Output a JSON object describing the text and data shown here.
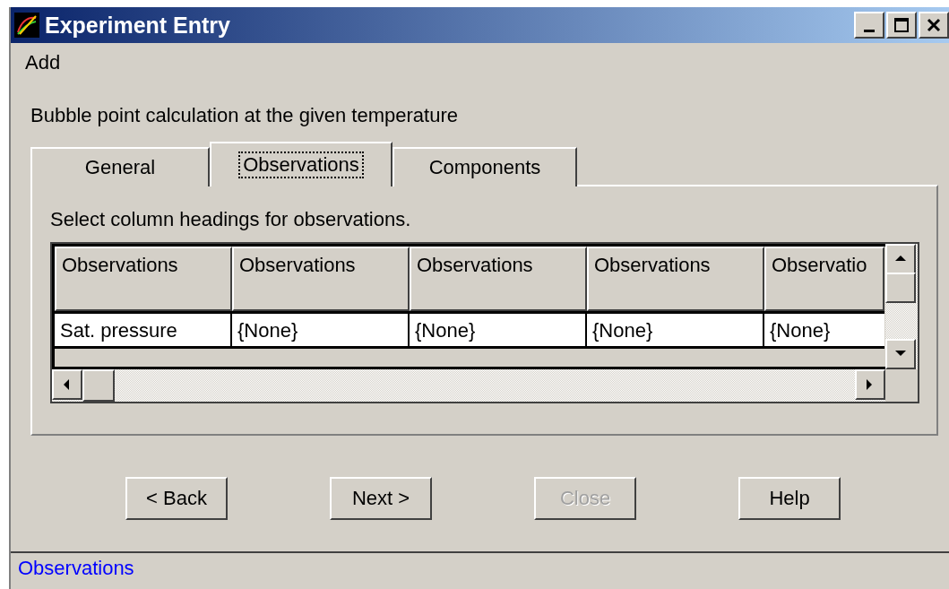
{
  "window": {
    "title": "Experiment Entry"
  },
  "menu": [
    "Add"
  ],
  "description": "Bubble point calculation at the given temperature",
  "tabs": [
    {
      "label": "General",
      "selected": false
    },
    {
      "label": "Observations",
      "selected": true
    },
    {
      "label": "Components",
      "selected": false
    }
  ],
  "instruction": "Select column headings for observations.",
  "table": {
    "columns": [
      "Observations",
      "Observations",
      "Observations",
      "Observations",
      "Observatio"
    ],
    "rows": [
      [
        "Sat. pressure",
        "{None}",
        "{None}",
        "{None}",
        "{None}"
      ]
    ]
  },
  "buttons": [
    {
      "label": "< Back",
      "disabled": false
    },
    {
      "label": "Next >",
      "disabled": false
    },
    {
      "label": "Close",
      "disabled": true
    },
    {
      "label": "Help",
      "disabled": false
    }
  ],
  "status_bar": "Observations"
}
